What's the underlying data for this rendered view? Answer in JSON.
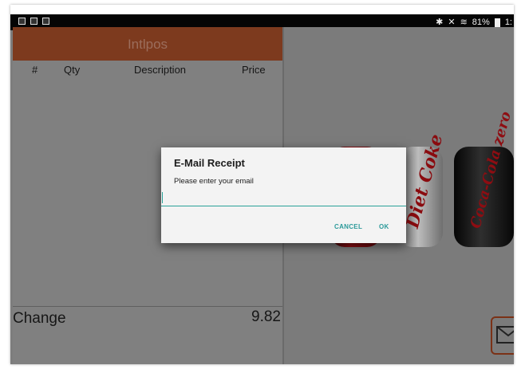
{
  "status_bar": {
    "left_icons": [
      "gallery-icon",
      "screenshot-icon",
      "android-icon"
    ],
    "right_icons": [
      "bluetooth-icon",
      "mute-icon",
      "wifi-icon"
    ],
    "battery_text": "81%",
    "time_fragment": "1:"
  },
  "app": {
    "title": "Intlpos",
    "columns": [
      "#",
      "Qty",
      "Description",
      "Price"
    ],
    "change_label": "Change",
    "change_value": "9.82"
  },
  "products": [
    "coca-cola-can",
    "diet-coke-can",
    "coke-zero-can"
  ],
  "can_labels": {
    "diet": "Diet Coke",
    "zero": "Coca-Cola zero"
  },
  "dialog": {
    "title": "E-Mail Receipt",
    "message": "Please enter your email",
    "input_value": "",
    "cancel_label": "CANCEL",
    "ok_label": "OK"
  },
  "colors": {
    "accent": "#7d3a1e",
    "dialog_button": "#2c9a9a",
    "input_underline": "#2aa198"
  }
}
